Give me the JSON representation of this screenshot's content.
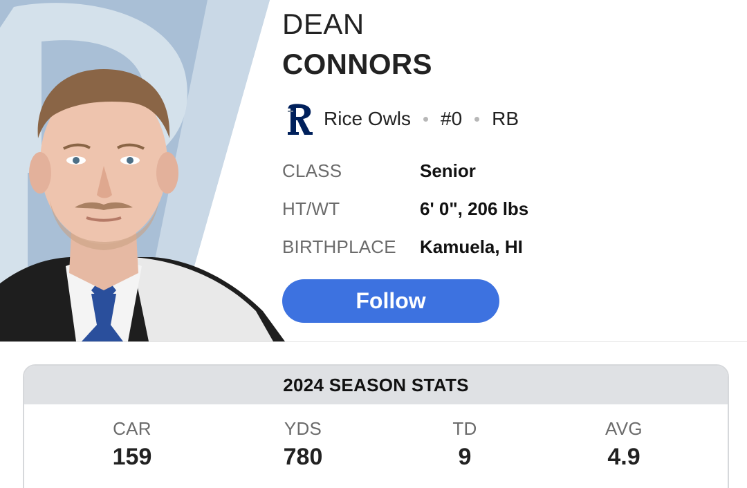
{
  "player": {
    "first_name": "DEAN",
    "last_name": "CONNORS",
    "team": "Rice Owls",
    "number": "#0",
    "position": "RB",
    "photo": "player-headshot"
  },
  "bio": [
    {
      "label": "CLASS",
      "value": "Senior"
    },
    {
      "label": "HT/WT",
      "value": "6' 0\", 206 lbs"
    },
    {
      "label": "BIRTHPLACE",
      "value": "Kamuela, HI"
    }
  ],
  "follow_label": "Follow",
  "stats": {
    "title": "2024 SEASON STATS",
    "items": [
      {
        "label": "CAR",
        "value": "159"
      },
      {
        "label": "YDS",
        "value": "780"
      },
      {
        "label": "TD",
        "value": "9"
      },
      {
        "label": "AVG",
        "value": "4.9"
      }
    ]
  },
  "colors": {
    "accent": "#3d72e0",
    "team_primary": "#00205b",
    "stats_header_bg": "#dfe1e4"
  },
  "icons": {
    "team_logo": "rice-owls-r-logo"
  }
}
